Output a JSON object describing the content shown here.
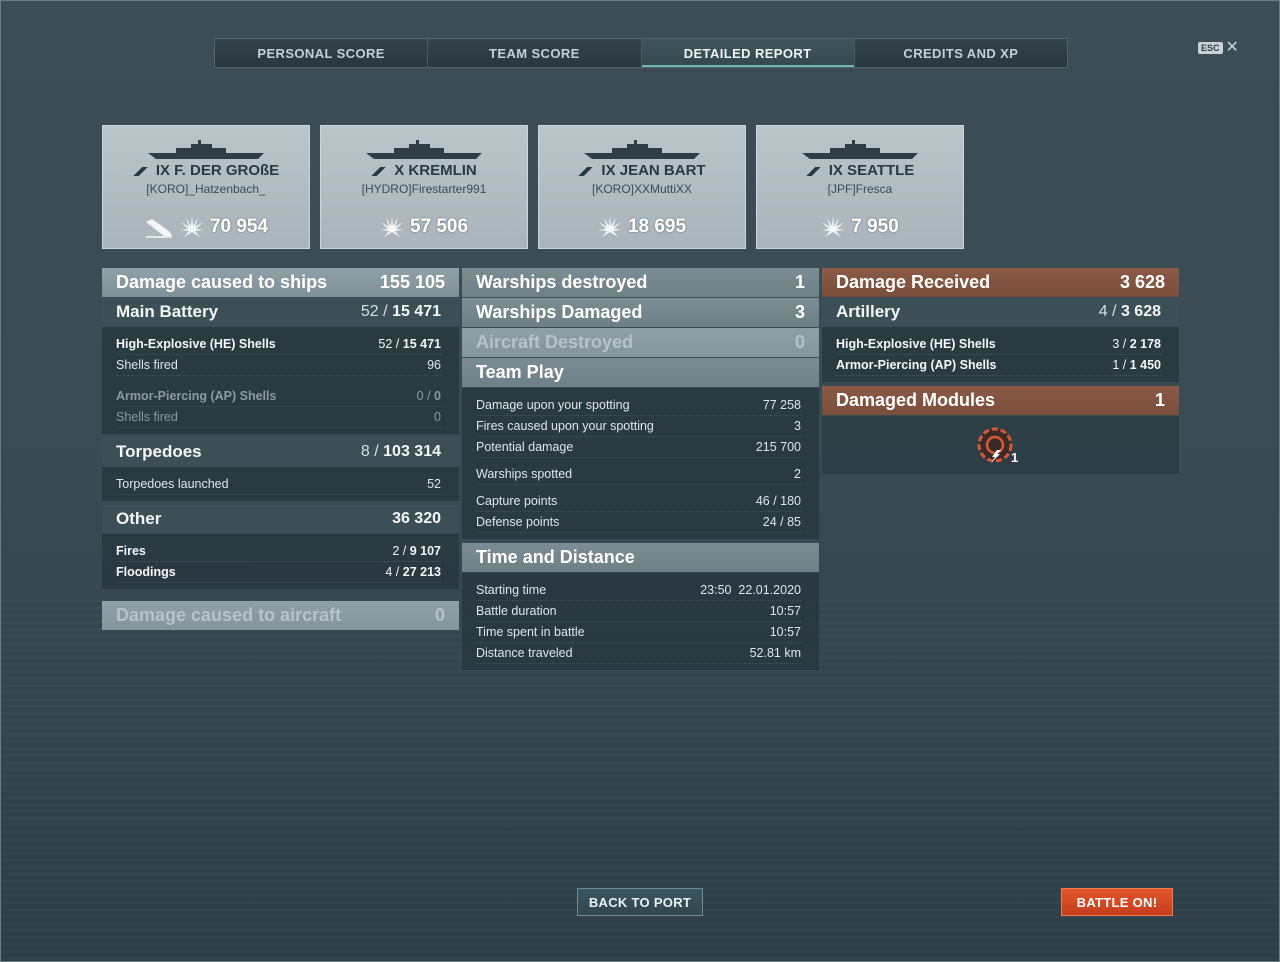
{
  "tabs": [
    "PERSONAL SCORE",
    "TEAM SCORE",
    "DETAILED REPORT",
    "CREDITS AND XP"
  ],
  "esc_label": "ESC",
  "close_glyph": "✕",
  "players": [
    {
      "ship": "IX F. DER GROßE",
      "player": "[KORO]_Hatzenbach_",
      "damage": "70 954",
      "sunk_icon": true
    },
    {
      "ship": "X KREMLIN",
      "player": "[HYDRO]Firestarter991",
      "damage": "57 506"
    },
    {
      "ship": "IX JEAN BART",
      "player": "[KORO]XXMuttiXX",
      "damage": "18 695"
    },
    {
      "ship": "IX SEATTLE",
      "player": "[JPF]Fresca",
      "damage": "7 950"
    }
  ],
  "left": {
    "damage_ships": {
      "label": "Damage caused to ships",
      "value": "155 105"
    },
    "main_battery": {
      "label": "Main Battery",
      "hits": "52",
      "value": "15 471"
    },
    "he": {
      "label": "High-Explosive (HE) Shells",
      "hits": "52",
      "value": "15 471"
    },
    "he_fired": {
      "label": "Shells fired",
      "value": "96"
    },
    "ap": {
      "label": "Armor-Piercing (AP) Shells",
      "hits": "0",
      "value": "0"
    },
    "ap_fired": {
      "label": "Shells fired",
      "value": "0"
    },
    "torpedoes": {
      "label": "Torpedoes",
      "hits": "8",
      "value": "103 314"
    },
    "torp_launched": {
      "label": "Torpedoes launched",
      "value": "52"
    },
    "other": {
      "label": "Other",
      "value": "36 320"
    },
    "fires": {
      "label": "Fires",
      "hits": "2",
      "value": "9 107"
    },
    "floodings": {
      "label": "Floodings",
      "hits": "4",
      "value": "27 213"
    },
    "damage_aircraft": {
      "label": "Damage caused to aircraft",
      "value": "0"
    },
    "sep": "/"
  },
  "middle": {
    "destroyed": {
      "label": "Warships destroyed",
      "value": "1"
    },
    "damaged": {
      "label": "Warships Damaged",
      "value": "3"
    },
    "aircraft": {
      "label": "Aircraft Destroyed",
      "value": "0"
    },
    "team_play": "Team Play",
    "spot_damage": {
      "label": "Damage upon your spotting",
      "value": "77 258"
    },
    "spot_fires": {
      "label": "Fires caused upon your spotting",
      "value": "3"
    },
    "potential": {
      "label": "Potential damage",
      "value": "215 700"
    },
    "spotted": {
      "label": "Warships spotted",
      "value": "2"
    },
    "capture": {
      "label": "Capture points",
      "value": "46 / 180"
    },
    "defense": {
      "label": "Defense points",
      "value": "24 / 85"
    },
    "time_distance": "Time and Distance",
    "start": {
      "label": "Starting time",
      "value": "23:50  22.01.2020"
    },
    "duration": {
      "label": "Battle duration",
      "value": "10:57"
    },
    "time_spent": {
      "label": "Time spent in battle",
      "value": "10:57"
    },
    "distance": {
      "label": "Distance traveled",
      "value": "52.81 km"
    }
  },
  "right": {
    "received": {
      "label": "Damage Received",
      "value": "3 628"
    },
    "artillery": {
      "label": "Artillery",
      "hits": "4",
      "value": "3 628"
    },
    "he": {
      "label": "High-Explosive (HE) Shells",
      "hits": "3",
      "value": "2 178"
    },
    "ap": {
      "label": "Armor-Piercing (AP) Shells",
      "hits": "1",
      "value": "1 450"
    },
    "modules": {
      "label": "Damaged Modules",
      "value": "1"
    },
    "module_count": "1"
  },
  "buttons": {
    "back": "BACK TO PORT",
    "battle": "BATTLE ON!"
  },
  "colors": {
    "accent": "#6fb6b1",
    "battle_button": "#d9492a",
    "received_header": "#8a5a45"
  }
}
